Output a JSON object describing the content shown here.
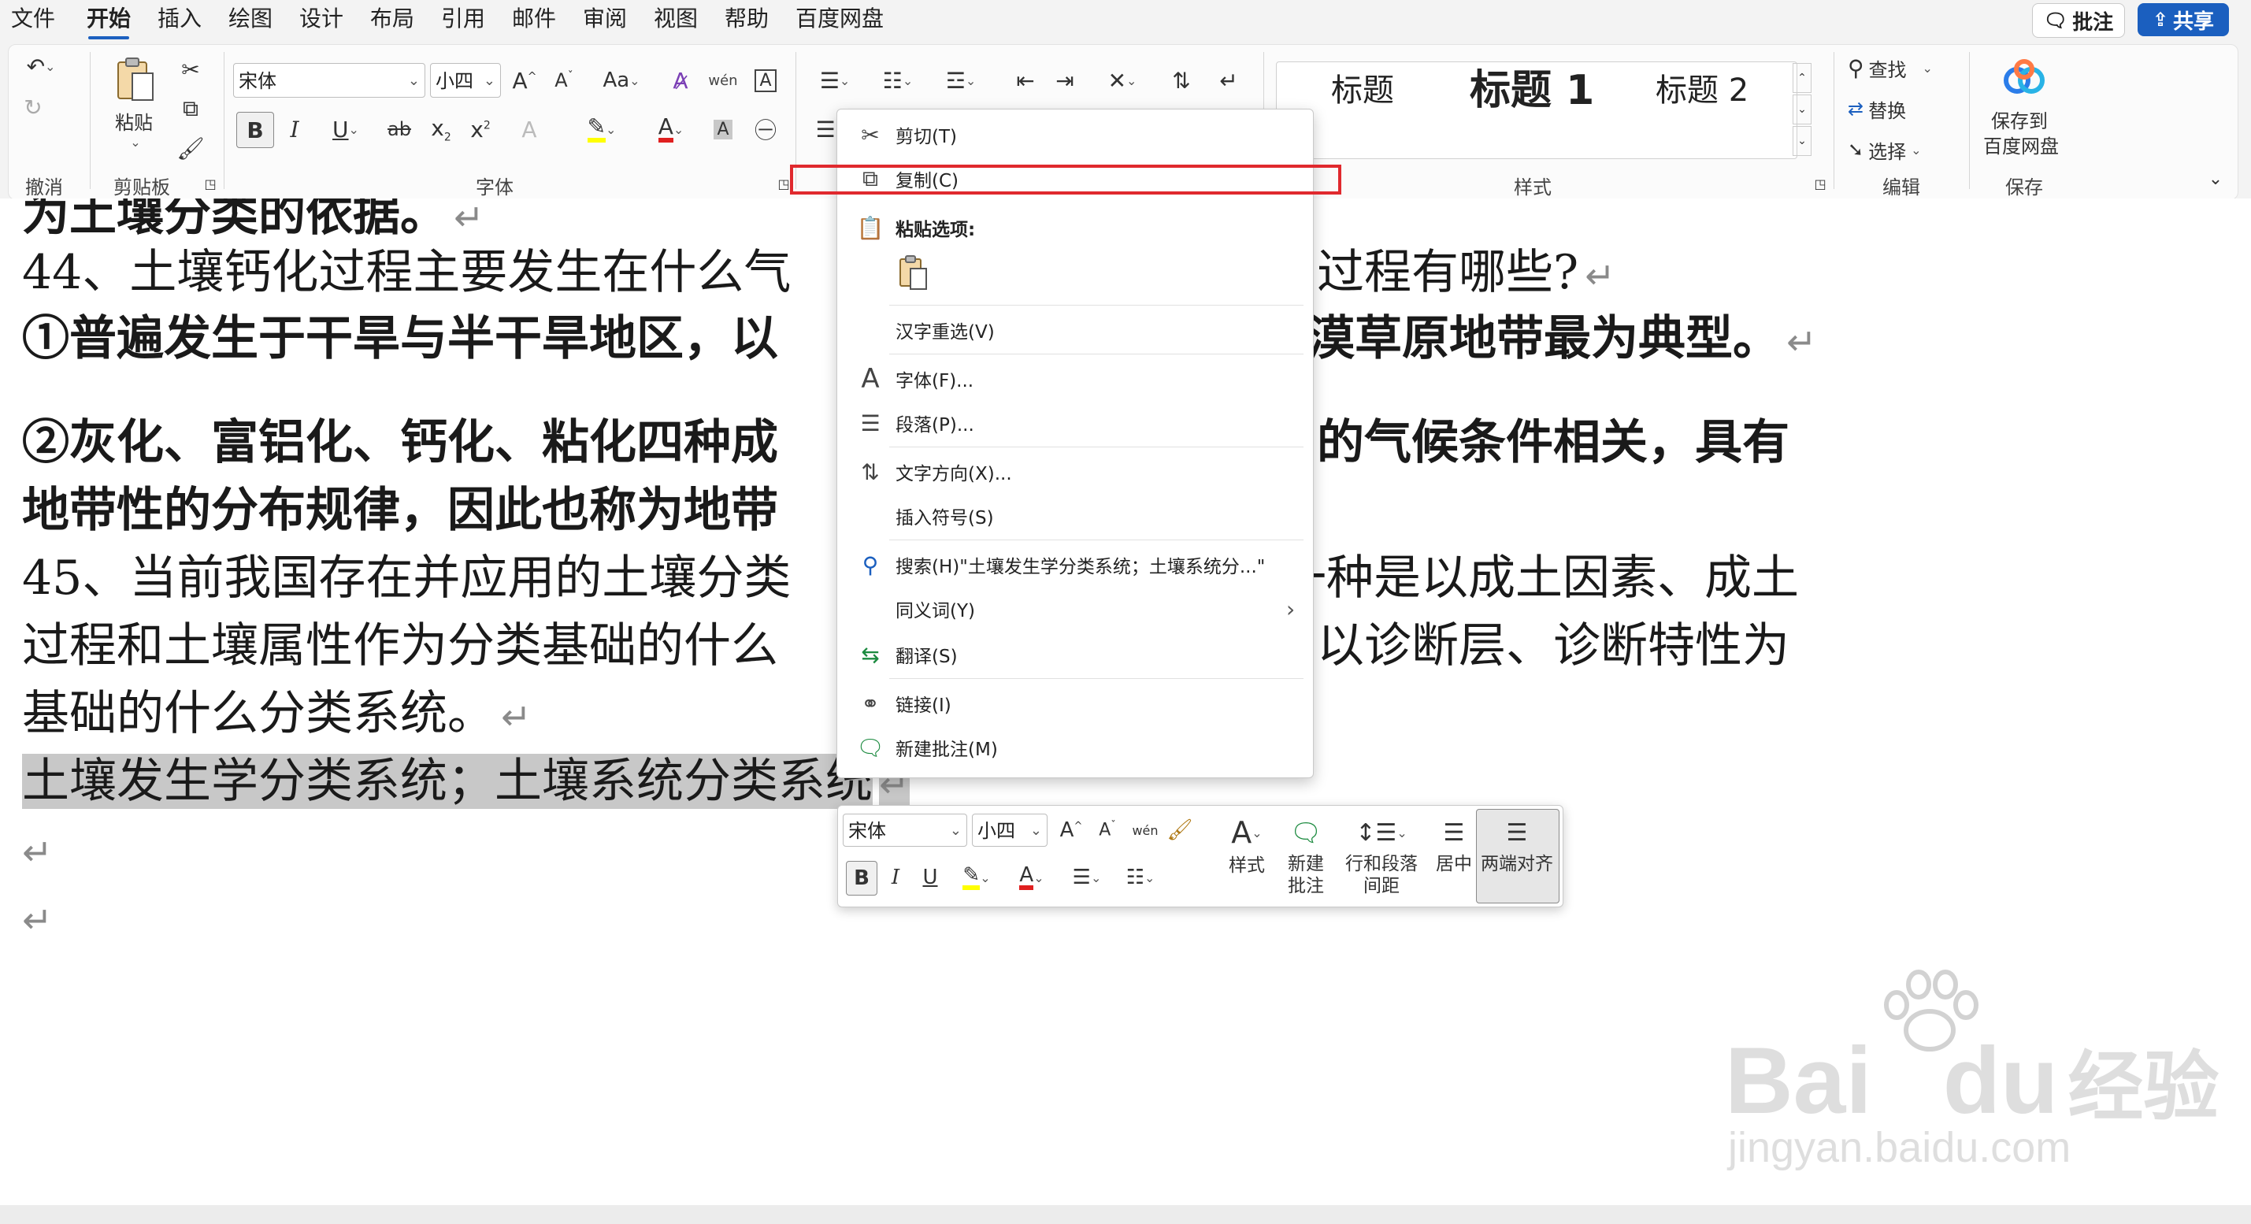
{
  "tabs": [
    "文件",
    "开始",
    "插入",
    "绘图",
    "设计",
    "布局",
    "引用",
    "邮件",
    "审阅",
    "视图",
    "帮助",
    "百度网盘"
  ],
  "active_tab": "开始",
  "top_buttons": {
    "comments": "批注",
    "share": "共享"
  },
  "ribbon": {
    "groups": {
      "undo": "撤消",
      "clipboard": "剪贴板",
      "font": "字体",
      "styles": "样式",
      "editing": "编辑",
      "save": "保存"
    },
    "clipboard": {
      "paste_label": "粘贴"
    },
    "font": {
      "font_name": "宋体",
      "font_size": "小四"
    },
    "styles": {
      "items": [
        "标题",
        "标题 1",
        "标题 2"
      ]
    },
    "editing": {
      "find": "查找",
      "replace": "替换",
      "select": "选择"
    },
    "save": {
      "line1": "保存到",
      "line2": "百度网盘"
    }
  },
  "document": {
    "lines": [
      {
        "text": "为土壤分类的依据。",
        "bold": true,
        "mark": "↵"
      },
      {
        "text_left": "44、土壤钙化过程主要发生在什么气",
        "text_right": "过程有哪些?",
        "bold": false,
        "mark": "↵"
      },
      {
        "text_left": "①普遍发生于干旱与半干旱地区，以",
        "text_right": "漠草原地带最为典型。",
        "bold": true,
        "mark": "↵"
      },
      {
        "text_left": "②灰化、富铝化、钙化、粘化四种成",
        "text_right": "的气候条件相关，具有",
        "bold": true,
        "mark": ""
      },
      {
        "text_left": "地带性的分布规律，因此也称为地带",
        "text_right": "",
        "bold": true,
        "mark": ""
      },
      {
        "text_left": "45、当前我国存在并应用的土壤分类",
        "text_right": "一种是以成土因素、成土",
        "bold": false,
        "mark": ""
      },
      {
        "text_left": "过程和土壤属性作为分类基础的什么",
        "text_right": "以诊断层、诊断特性为",
        "bold": false,
        "mark": ""
      },
      {
        "text": "基础的什么分类系统。",
        "bold": false,
        "mark": "↵"
      },
      {
        "text": "土壤发生学分类系统；土壤系统分类系统",
        "bold": false,
        "mark": "↵",
        "selected": true
      },
      {
        "text": "",
        "mark": "↵"
      },
      {
        "text": "",
        "mark": "↵"
      }
    ]
  },
  "context_menu": {
    "cut": "剪切(T)",
    "copy": "复制(C)",
    "paste_options": "粘贴选项:",
    "reconvert": "汉字重选(V)",
    "font": "字体(F)...",
    "paragraph": "段落(P)...",
    "text_direction": "文字方向(X)...",
    "insert_symbol": "插入符号(S)",
    "search": "搜索(H)\"土壤发生学分类系统；土壤系统分...\"",
    "synonyms": "同义词(Y)",
    "translate": "翻译(S)",
    "link": "链接(I)",
    "new_comment": "新建批注(M)"
  },
  "mini_toolbar": {
    "font_name": "宋体",
    "font_size": "小四",
    "styles": "样式",
    "new_comment_1": "新建",
    "new_comment_2": "批注",
    "spacing_1": "行和段落",
    "spacing_2": "间距",
    "center": "居中",
    "justify": "两端对齐"
  },
  "watermark": {
    "line1": "Bai",
    "line1b": "du",
    "line1c": "经验",
    "line2": "jingyan.baidu.com"
  },
  "colors": {
    "accent": "#1b5fbf",
    "highlight_box": "#e0292e",
    "selection": "#c8c8c8",
    "font_color": "#e02020",
    "highlighter": "#ffff00"
  }
}
